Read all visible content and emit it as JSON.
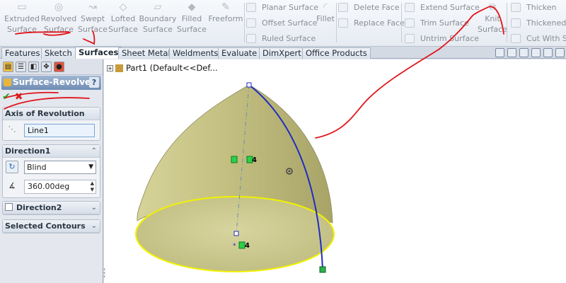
{
  "ribbon": {
    "buttons": [
      {
        "line1": "Extruded",
        "line2": "Surface"
      },
      {
        "line1": "Revolved",
        "line2": "Surface"
      },
      {
        "line1": "Swept",
        "line2": "Surface"
      },
      {
        "line1": "Lofted",
        "line2": "Surface"
      },
      {
        "line1": "Boundary",
        "line2": "Surface"
      },
      {
        "line1": "Filled",
        "line2": "Surface"
      },
      {
        "line1": "Freeform",
        "line2": ""
      }
    ],
    "group1": [
      "Planar Surface",
      "Offset Surface",
      "Ruled Surface"
    ],
    "fillet": "Fillet",
    "group2": [
      "Delete Face",
      "Replace Face"
    ],
    "group3": [
      "Extend Surface",
      "Trim Surface",
      "Untrim Surface"
    ],
    "knit": {
      "line1": "Knit",
      "line2": "Surface"
    },
    "group4": [
      "Thicken",
      "Thickened C",
      "Cut With Su"
    ]
  },
  "tabs": [
    "Features",
    "Sketch",
    "Surfaces",
    "Sheet Metal",
    "Weldments",
    "Evaluate",
    "DimXpert",
    "Office Products"
  ],
  "active_tab": "Surfaces",
  "property_manager": {
    "title": "Surface-Revolve",
    "help": "?",
    "axis": {
      "header": "Axis of Revolution",
      "value": "Line1"
    },
    "direction1": {
      "header": "Direction1",
      "type": "Blind",
      "angle": "360.00deg"
    },
    "direction2": {
      "header": "Direction2"
    },
    "contours": {
      "header": "Selected Contours"
    }
  },
  "tree": {
    "label": "Part1  (Default<<Def..."
  },
  "handles": {
    "h1": "4",
    "h2": "4"
  },
  "colors": {
    "surface": "#c8c48a",
    "profile": "#1f2dbf",
    "edge": "#f2f200",
    "annotation": "#e0141a"
  }
}
